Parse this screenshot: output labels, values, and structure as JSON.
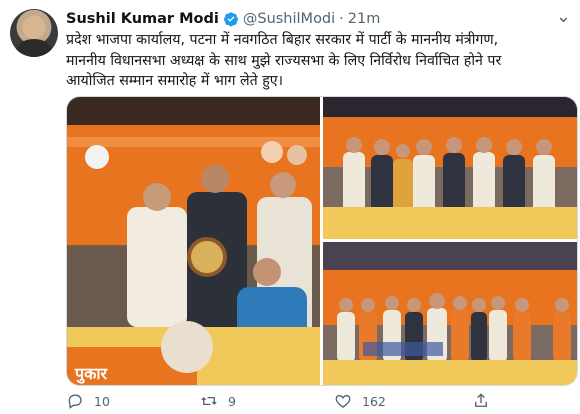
{
  "tweet": {
    "author_name": "Sushil Kumar Modi",
    "handle": "@SushilModi",
    "separator": "·",
    "time": "21m",
    "text_lines": [
      "प्रदेश भाजपा कार्यालय, पटना में नवगठित बिहार सरकार में पार्टी के माननीय मंत्रीगण,",
      "माननीय विधानसभा अध्यक्ष के साथ मुझे राज्यसभा के लिए निर्विरोध निर्वाचित होने पर",
      "आयोजित सम्मान समारोह में भाग लेते हुए।"
    ],
    "banner_text": "पुकार"
  },
  "actions": {
    "reply_count": "10",
    "retweet_count": "9",
    "like_count": "162"
  },
  "icons": {
    "avatar": "avatar",
    "verified": "verified-badge-icon",
    "more": "more-icon",
    "reply": "reply-icon",
    "retweet": "retweet-icon",
    "like": "heart-icon",
    "share": "share-icon"
  },
  "colors": {
    "verified_blue": "#1d9bf0",
    "secondary_text": "#536471",
    "stage_orange": "#e8741f"
  }
}
